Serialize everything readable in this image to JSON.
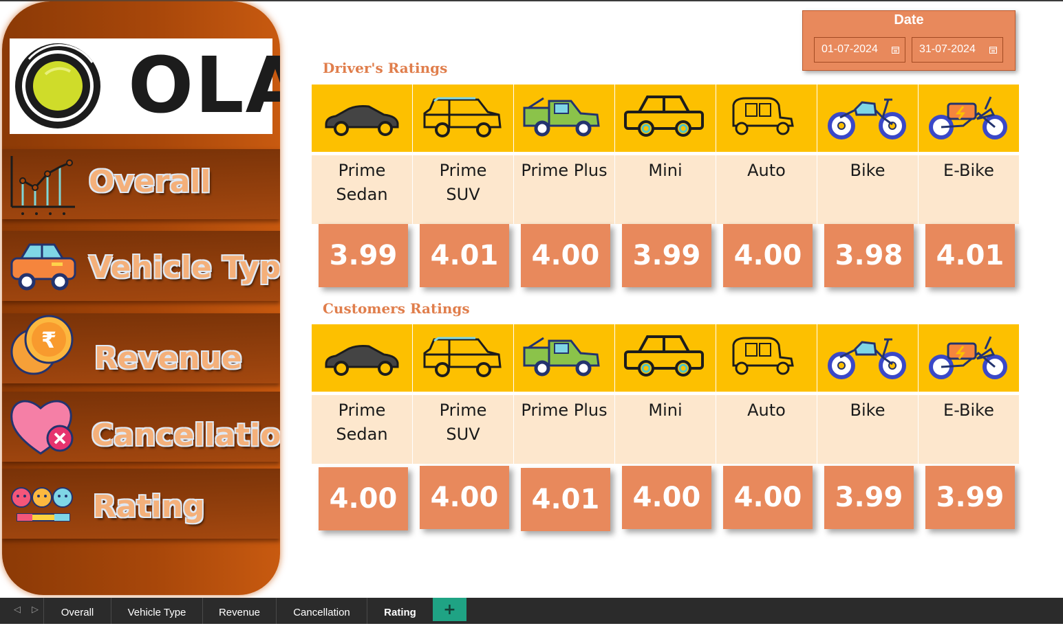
{
  "sidebar": {
    "logo_text": "OLA",
    "items": [
      {
        "label": "Overall",
        "icon": "line-chart-icon"
      },
      {
        "label": "Vehicle Type",
        "icon": "car-icon"
      },
      {
        "label": "Revenue",
        "icon": "rupee-coin-icon"
      },
      {
        "label": "Cancellation",
        "icon": "heart-cancel-icon"
      },
      {
        "label": "Rating",
        "icon": "emoji-rating-icon"
      }
    ]
  },
  "date_filter": {
    "title": "Date",
    "start": "01-07-2024",
    "end": "31-07-2024"
  },
  "drivers": {
    "title": "Driver's Ratings",
    "vehicles": [
      {
        "line1": "Prime",
        "line2": "Sedan",
        "value": "3.99"
      },
      {
        "line1": "Prime",
        "line2": "SUV",
        "value": "4.01"
      },
      {
        "line1": "Prime Plus",
        "line2": "",
        "value": "4.00"
      },
      {
        "line1": "Mini",
        "line2": "",
        "value": "3.99"
      },
      {
        "line1": "Auto",
        "line2": "",
        "value": "4.00"
      },
      {
        "line1": "Bike",
        "line2": "",
        "value": "3.98"
      },
      {
        "line1": "E-Bike",
        "line2": "",
        "value": "4.01"
      }
    ]
  },
  "customers": {
    "title": "Customers Ratings",
    "vehicles": [
      {
        "line1": "Prime",
        "line2": "Sedan",
        "value": "4.00"
      },
      {
        "line1": "Prime",
        "line2": "SUV",
        "value": "4.00"
      },
      {
        "line1": "Prime Plus",
        "line2": "",
        "value": "4.01"
      },
      {
        "line1": "Mini",
        "line2": "",
        "value": "4.00"
      },
      {
        "line1": "Auto",
        "line2": "",
        "value": "4.00"
      },
      {
        "line1": "Bike",
        "line2": "",
        "value": "3.99"
      },
      {
        "line1": "E-Bike",
        "line2": "",
        "value": "3.99"
      }
    ]
  },
  "tabs": {
    "items": [
      "Overall",
      "Vehicle Type",
      "Revenue",
      "Cancellation",
      "Rating"
    ],
    "active": "Rating",
    "add_label": "+"
  },
  "colors": {
    "accent": "#e8895c",
    "header_yellow": "#fdc000",
    "name_bg": "#fde7cd",
    "sidebar_brown": "#a8470a",
    "tab_add": "#1fa384"
  }
}
